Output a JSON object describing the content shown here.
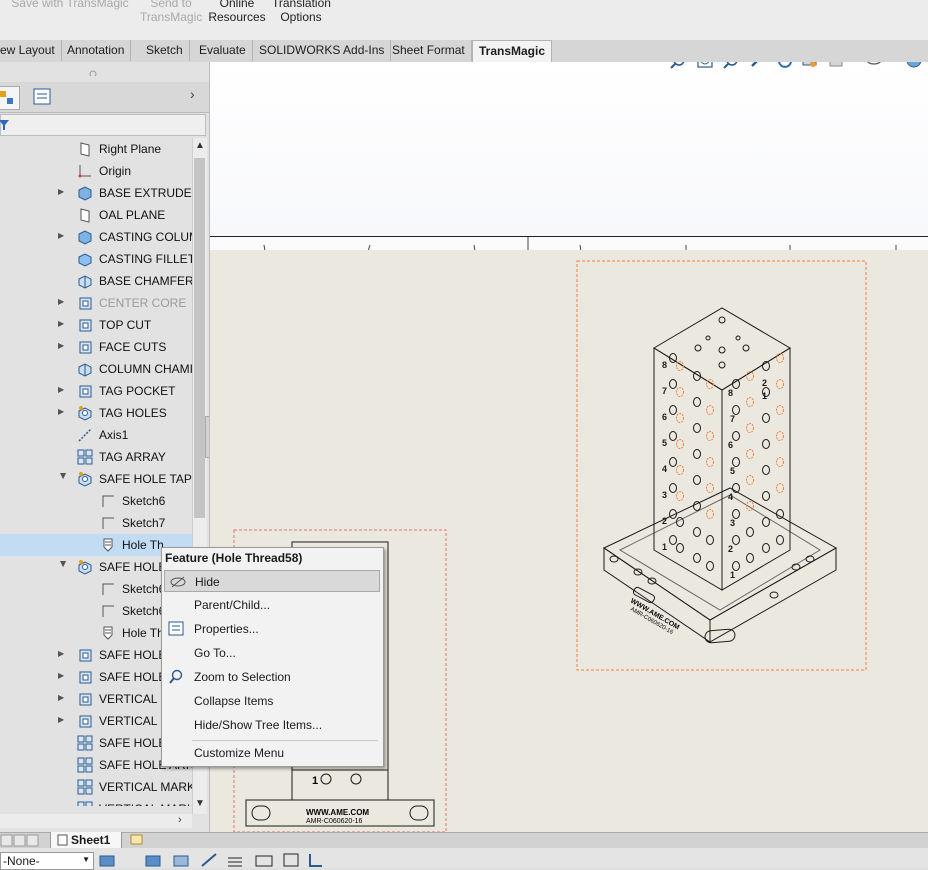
{
  "ribbon": {
    "save_transmagic": "Save with TransMagic",
    "send_line1": "Send to",
    "send_line2": "TransMagic",
    "online_line1": "Online",
    "online_line2": "Resources",
    "trans_line1": "Translation",
    "trans_line2": "Options"
  },
  "tabs": [
    "ew Layout",
    "Annotation",
    "Sketch",
    "Evaluate",
    "SOLIDWORKS Add-Ins",
    "Sheet Format",
    "TransMagic"
  ],
  "tree": [
    {
      "label": "Right Plane",
      "icon": "plane-icon",
      "expand": false
    },
    {
      "label": "Origin",
      "icon": "origin-icon",
      "expand": false
    },
    {
      "label": "BASE EXTRUDE",
      "icon": "extrude-icon",
      "expand": true
    },
    {
      "label": "OAL PLANE",
      "icon": "plane-icon",
      "expand": false
    },
    {
      "label": "CASTING COLUM",
      "icon": "extrude-icon",
      "expand": true
    },
    {
      "label": "CASTING FILLET",
      "icon": "fillet-icon",
      "expand": false
    },
    {
      "label": "BASE CHAMFER",
      "icon": "chamfer-icon",
      "expand": false
    },
    {
      "label": "CENTER CORE",
      "icon": "cut-icon",
      "expand": true,
      "dim": true
    },
    {
      "label": "TOP CUT",
      "icon": "cut-icon",
      "expand": true
    },
    {
      "label": "FACE CUTS",
      "icon": "cut-icon",
      "expand": true
    },
    {
      "label": "COLUMN CHAMI",
      "icon": "chamfer-icon",
      "expand": false
    },
    {
      "label": "TAG POCKET",
      "icon": "cut-icon",
      "expand": true
    },
    {
      "label": "TAG HOLES",
      "icon": "hole-wizard-icon",
      "expand": true
    },
    {
      "label": "Axis1",
      "icon": "axis-icon",
      "expand": false
    },
    {
      "label": "TAG ARRAY",
      "icon": "pattern-icon",
      "expand": false
    },
    {
      "label": "SAFE HOLE  TAP",
      "icon": "hole-wizard-icon",
      "expand": true,
      "open": true
    },
    {
      "label": "Sketch6",
      "icon": "sketch-icon",
      "indent": 1
    },
    {
      "label": "Sketch7",
      "icon": "sketch-icon",
      "indent": 1
    },
    {
      "label": "Hole Th",
      "icon": "thread-icon",
      "indent": 1,
      "selected": true
    },
    {
      "label": "SAFE HOLE",
      "icon": "hole-wizard-icon",
      "expand": true,
      "open": true
    },
    {
      "label": "Sketch6",
      "icon": "sketch-icon",
      "indent": 1
    },
    {
      "label": "Sketch6",
      "icon": "sketch-icon",
      "indent": 1
    },
    {
      "label": "Hole Th",
      "icon": "thread-icon",
      "indent": 1
    },
    {
      "label": "SAFE HOLE",
      "icon": "cut-icon",
      "expand": true
    },
    {
      "label": "SAFE HOLE",
      "icon": "cut-icon",
      "expand": true
    },
    {
      "label": "VERTICAL M",
      "icon": "cut-icon",
      "expand": true
    },
    {
      "label": "VERTICAL M",
      "icon": "cut-icon",
      "expand": true
    },
    {
      "label": "SAFE HOLE",
      "icon": "pattern-icon",
      "expand": false
    },
    {
      "label": "SAFE HOLE ARRA",
      "icon": "pattern-icon",
      "expand": false
    },
    {
      "label": "VERTICAL MARKI",
      "icon": "pattern-icon",
      "expand": false
    },
    {
      "label": "VERTICAL MARKI",
      "icon": "pattern-icon",
      "expand": false
    }
  ],
  "context_menu": {
    "title": "Feature (Hole Thread58)",
    "items": [
      {
        "label": "Hide",
        "icon": "hide-eye-icon",
        "highlighted": true
      },
      {
        "label": "Parent/Child..."
      },
      {
        "label": "Properties...",
        "icon": "properties-icon"
      },
      {
        "label": "Go To..."
      },
      {
        "label": "Zoom to Selection",
        "icon": "zoom-selection-icon"
      },
      {
        "label": "Collapse Items"
      },
      {
        "label": "Hide/Show Tree Items..."
      },
      {
        "label": "Customize Menu",
        "separator_before": true
      }
    ]
  },
  "drawing": {
    "face_numbers_left": [
      "8",
      "7",
      "6",
      "5",
      "4",
      "3",
      "2",
      "1"
    ],
    "face_numbers_right": [
      "2",
      "1",
      "8",
      "7",
      "6",
      "5",
      "4",
      "3",
      "2",
      "1"
    ],
    "tag_line1": "WWW.AME.COM",
    "tag_line2": "AMR-C060620-16",
    "view_numbers": "1",
    "accent_dashed": "#f08040",
    "accent_pink": "#e07070"
  },
  "bottom": {
    "sheet_tab": "Sheet1",
    "layer_select": "-None-"
  }
}
